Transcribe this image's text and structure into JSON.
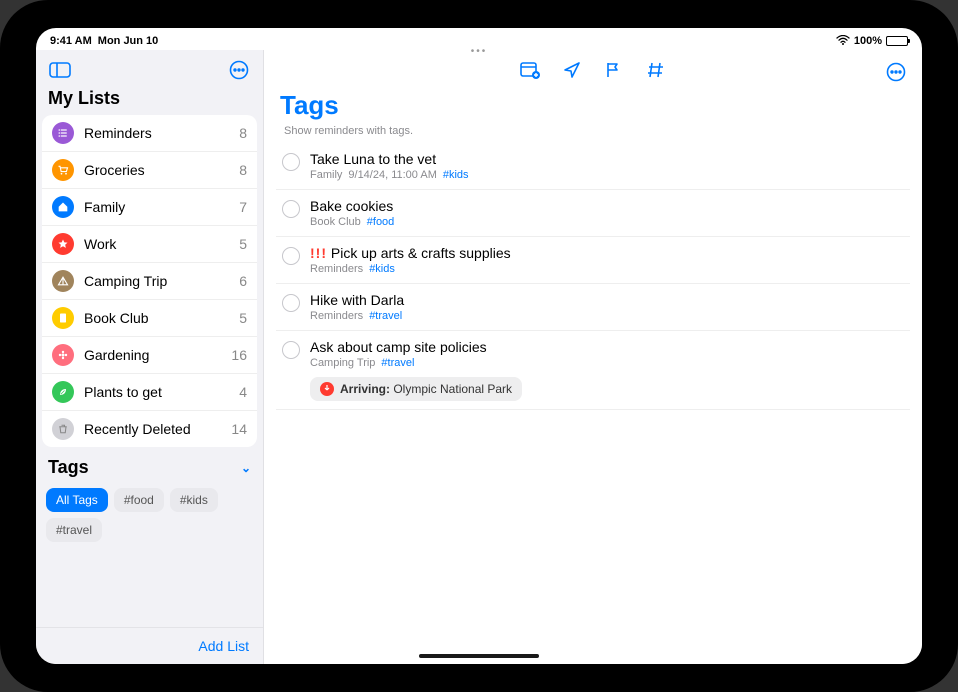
{
  "status": {
    "time": "9:41 AM",
    "date": "Mon Jun 10",
    "battery": "100%"
  },
  "sidebar": {
    "heading": "My Lists",
    "lists": [
      {
        "name": "Reminders",
        "count": "8",
        "color": "#9a59d6",
        "icon": "list"
      },
      {
        "name": "Groceries",
        "count": "8",
        "color": "#ff9500",
        "icon": "cart"
      },
      {
        "name": "Family",
        "count": "7",
        "color": "#007aff",
        "icon": "home"
      },
      {
        "name": "Work",
        "count": "5",
        "color": "#ff3b30",
        "icon": "star"
      },
      {
        "name": "Camping Trip",
        "count": "6",
        "color": "#a0845c",
        "icon": "tent"
      },
      {
        "name": "Book Club",
        "count": "5",
        "color": "#ffcc00",
        "icon": "book"
      },
      {
        "name": "Gardening",
        "count": "16",
        "color": "#ff6e7e",
        "icon": "flower"
      },
      {
        "name": "Plants to get",
        "count": "4",
        "color": "#34c759",
        "icon": "leaf"
      },
      {
        "name": "Recently Deleted",
        "count": "14",
        "color": "#d1d1d6",
        "icon": "trash"
      }
    ],
    "tags_heading": "Tags",
    "tags": [
      {
        "label": "All Tags",
        "selected": true
      },
      {
        "label": "#food",
        "selected": false
      },
      {
        "label": "#kids",
        "selected": false
      },
      {
        "label": "#travel",
        "selected": false
      }
    ],
    "add_list": "Add List"
  },
  "main": {
    "title": "Tags",
    "subtitle": "Show reminders with tags.",
    "reminders": [
      {
        "title": "Take Luna to the vet",
        "list": "Family",
        "date": "9/14/24, 11:00 AM",
        "tags": [
          "#kids"
        ],
        "priority": "",
        "location": ""
      },
      {
        "title": "Bake cookies",
        "list": "Book Club",
        "date": "",
        "tags": [
          "#food"
        ],
        "priority": "",
        "location": ""
      },
      {
        "title": "Pick up arts & crafts supplies",
        "list": "Reminders",
        "date": "",
        "tags": [
          "#kids"
        ],
        "priority": "!!!",
        "location": ""
      },
      {
        "title": "Hike with Darla",
        "list": "Reminders",
        "date": "",
        "tags": [
          "#travel"
        ],
        "priority": "",
        "location": ""
      },
      {
        "title": "Ask about camp site policies",
        "list": "Camping Trip",
        "date": "",
        "tags": [
          "#travel"
        ],
        "priority": "",
        "location_label": "Arriving:",
        "location": "Olympic National Park"
      }
    ]
  }
}
